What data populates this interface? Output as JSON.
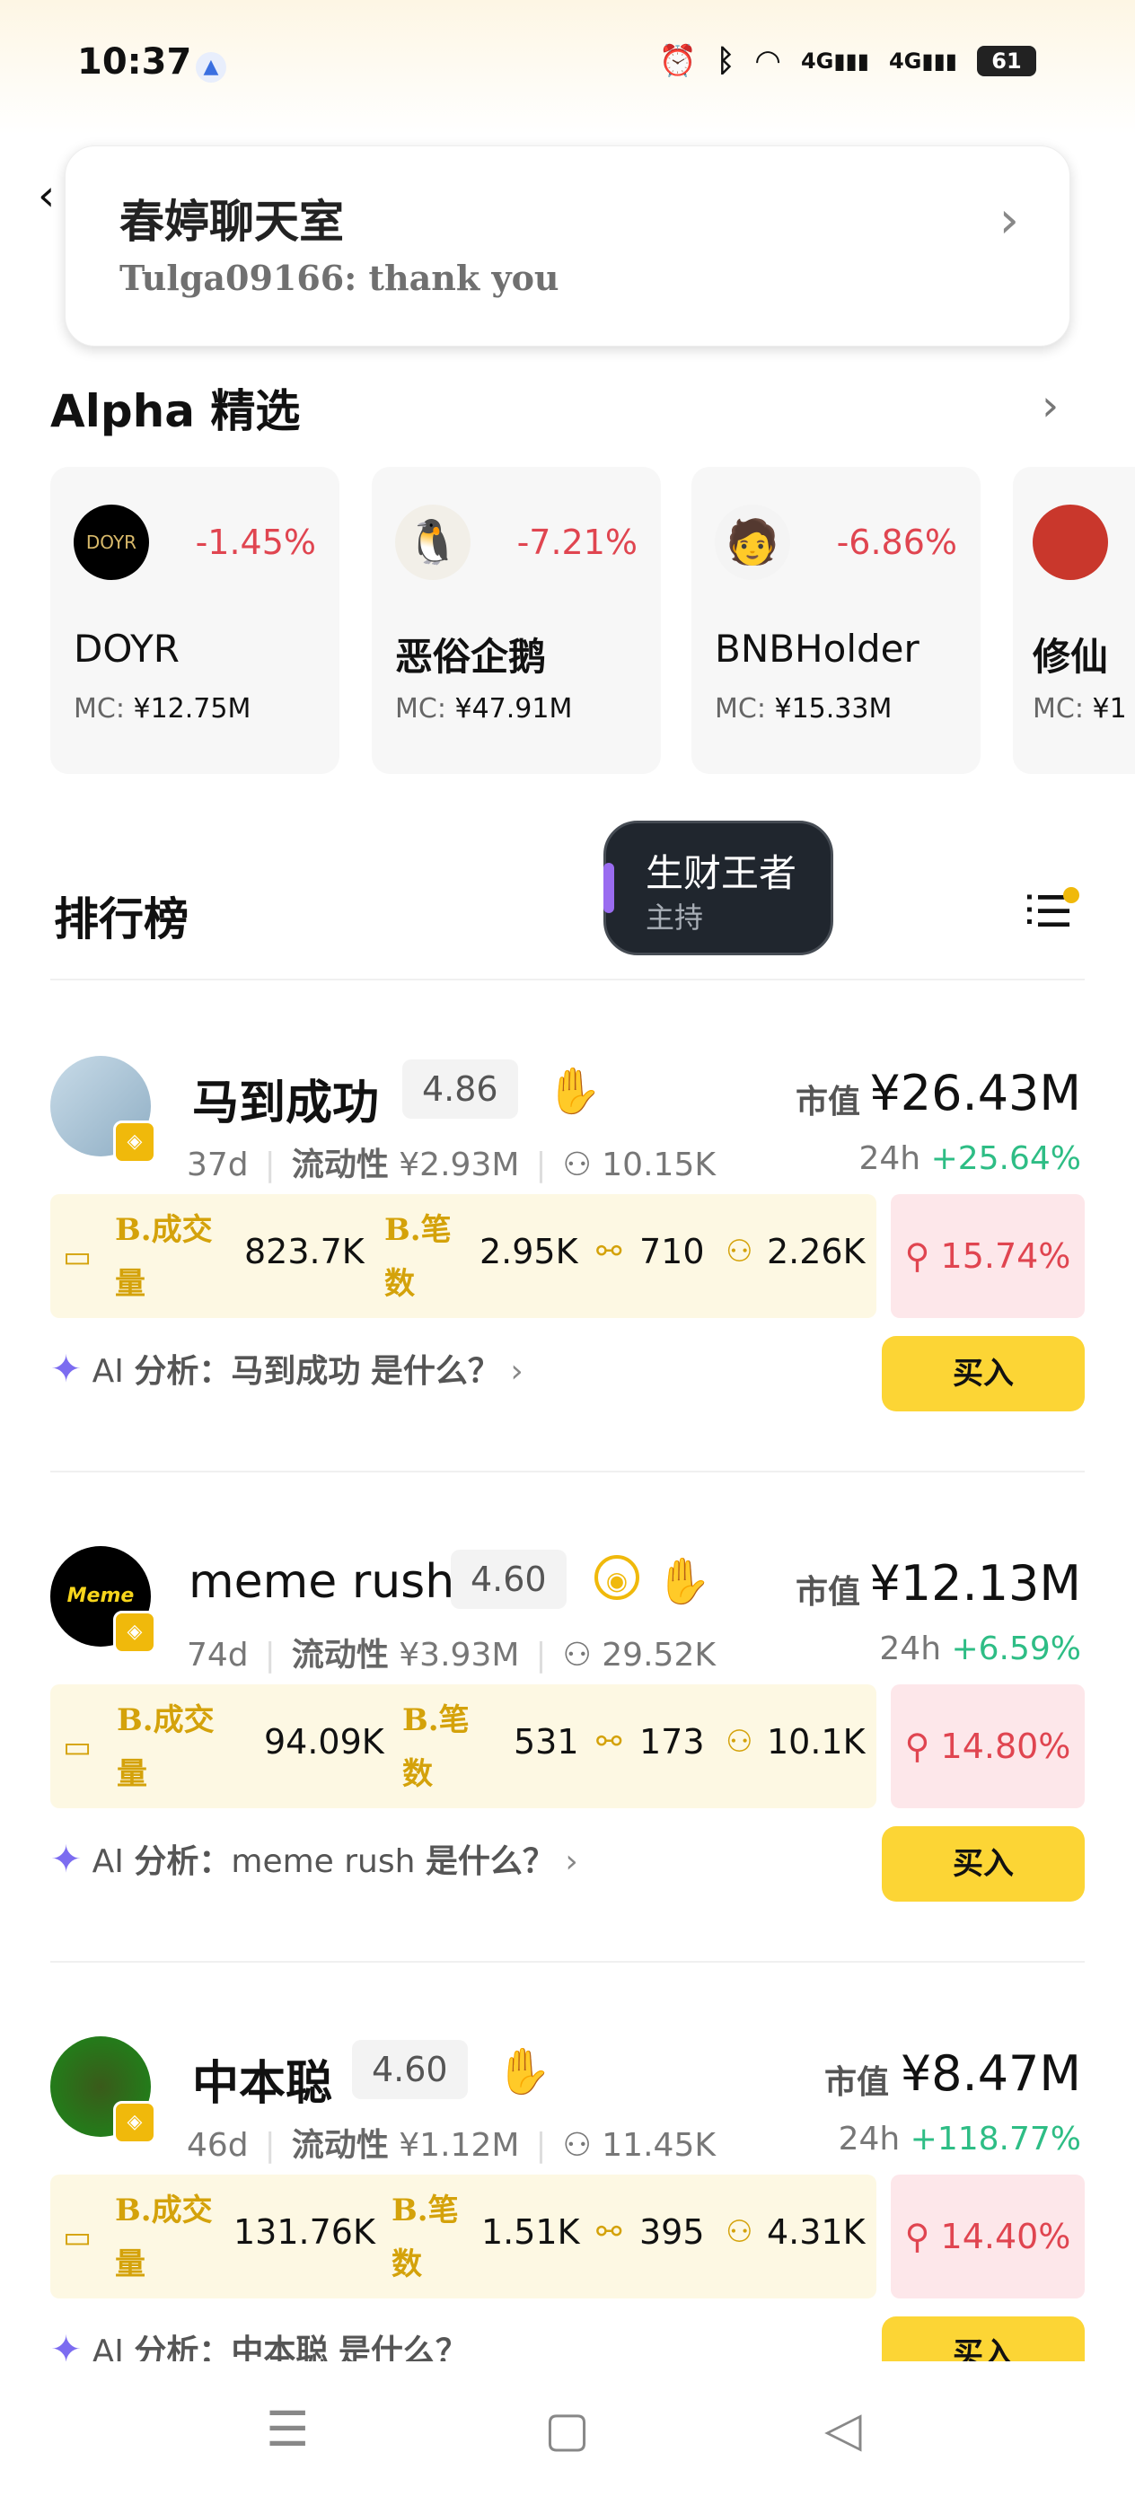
{
  "status": {
    "time": "10:37",
    "battery": "61",
    "net1": "4G",
    "net2": "4G"
  },
  "chat": {
    "title": "春婷聊天室",
    "last_message": "Tulga09166: thank you"
  },
  "alpha": {
    "title": "Alpha 精选",
    "mc_label": "MC:",
    "cards": [
      {
        "name": "DOYR",
        "change": "-1.45%",
        "mc": "¥12.75M",
        "logo_text": "DOYR"
      },
      {
        "name": "恶俗企鹅",
        "change": "-7.21%",
        "mc": "¥47.91M",
        "logo_text": ""
      },
      {
        "name": "BNBHolder",
        "change": "-6.86%",
        "mc": "¥15.33M",
        "logo_text": ""
      },
      {
        "name": "修仙",
        "change": "",
        "mc": "¥1",
        "logo_text": ""
      }
    ]
  },
  "ranking": {
    "title": "排行榜"
  },
  "host": {
    "name": "生财王者",
    "role": "主持"
  },
  "labels": {
    "market_value": "市值",
    "liquidity": "流动性",
    "h24": "24h",
    "b_volume_1": "B.成交",
    "b_volume_2": "量",
    "b_count_1": "B.笔",
    "b_count_2": "数",
    "ai_prefix": "AI",
    "ai_label": "分析：",
    "ai_suffix": "是什么？",
    "buy": "买入"
  },
  "tokens": [
    {
      "name": "马到成功",
      "score": "4.86",
      "market_value": "¥26.43M",
      "age": "37d",
      "liquidity": "¥2.93M",
      "holders": "10.15K",
      "change_24h": "+25.64%",
      "b_volume": "823.7K",
      "b_count": "2.95K",
      "stat3": "710",
      "stat4": "2.26K",
      "pct": "15.74%"
    },
    {
      "name": "meme rush",
      "score": "4.60",
      "market_value": "¥12.13M",
      "age": "74d",
      "liquidity": "¥3.93M",
      "holders": "29.52K",
      "change_24h": "+6.59%",
      "b_volume": "94.09K",
      "b_count": "531",
      "stat3": "173",
      "stat4": "10.1K",
      "pct": "14.80%"
    },
    {
      "name": "中本聪",
      "score": "4.60",
      "market_value": "¥8.47M",
      "age": "46d",
      "liquidity": "¥1.12M",
      "holders": "11.45K",
      "change_24h": "+118.77%",
      "b_volume": "131.76K",
      "b_count": "1.51K",
      "stat3": "395",
      "stat4": "4.31K",
      "pct": "14.40%"
    }
  ],
  "icons": {
    "back": "back-arrow-icon",
    "menu": "menu-icon",
    "home": "home-icon",
    "nav_back": "nav-back-icon"
  },
  "colors": {
    "accent": "#fcd535",
    "up": "#2ebd85",
    "down": "#e04550"
  }
}
